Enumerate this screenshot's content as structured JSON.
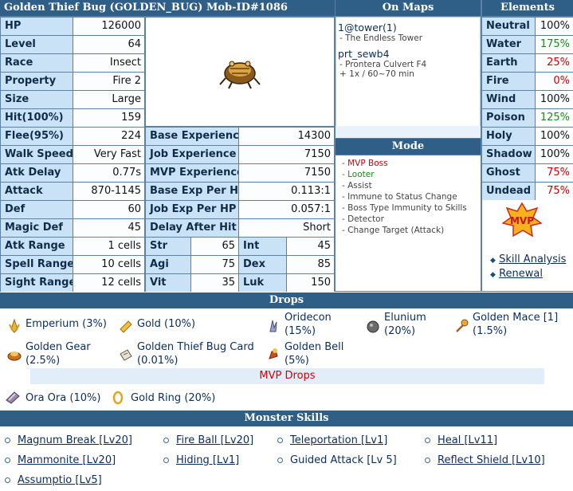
{
  "header": {
    "title": "Golden Thief Bug  (GOLDEN_BUG)  Mob-ID#1086",
    "on_maps": "On Maps",
    "elements": "Elements"
  },
  "stats": {
    "hp": {
      "label": "HP",
      "value": "126000"
    },
    "level": {
      "label": "Level",
      "value": "64"
    },
    "race": {
      "label": "Race",
      "value": "Insect"
    },
    "property": {
      "label": "Property",
      "value": "Fire 2"
    },
    "size": {
      "label": "Size",
      "value": "Large"
    },
    "hit": {
      "label": "Hit(100%)",
      "value": "159"
    },
    "flee": {
      "label": "Flee(95%)",
      "value": "224"
    },
    "walk_speed": {
      "label": "Walk Speed",
      "value": "Very Fast"
    },
    "atk_delay": {
      "label": "Atk Delay",
      "value": "0.77s"
    },
    "attack": {
      "label": "Attack",
      "value": "870-1145"
    },
    "def": {
      "label": "Def",
      "value": "60"
    },
    "magic_def": {
      "label": "Magic Def",
      "value": "45"
    },
    "atk_range": {
      "label": "Atk Range",
      "value": "1 cells"
    },
    "spell_range": {
      "label": "Spell Range",
      "value": "10 cells"
    },
    "sight_range": {
      "label": "Sight Range",
      "value": "12 cells"
    }
  },
  "exp": {
    "base_exp": {
      "label": "Base Experience",
      "value": "14300"
    },
    "job_exp": {
      "label": "Job Experience",
      "value": "7150"
    },
    "mvp_exp": {
      "label": "MVP Experience",
      "value": "7150"
    },
    "base_per_hp": {
      "label": "Base Exp Per HP",
      "value": "0.113:1"
    },
    "job_per_hp": {
      "label": "Job Exp Per HP",
      "value": "0.057:1"
    },
    "delay_after_hit": {
      "label": "Delay After Hit",
      "value": "Short"
    }
  },
  "attrs": {
    "str": {
      "label": "Str",
      "value": "65"
    },
    "int": {
      "label": "Int",
      "value": "45"
    },
    "agi": {
      "label": "Agi",
      "value": "75"
    },
    "dex": {
      "label": "Dex",
      "value": "85"
    },
    "vit": {
      "label": "Vit",
      "value": "35"
    },
    "luk": {
      "label": "Luk",
      "value": "150"
    }
  },
  "maps": [
    {
      "name": "1@tower(1)",
      "sub": "- The Endless Tower"
    },
    {
      "name": "prt_sewb4",
      "sub": "- Prontera Culvert F4",
      "extra": "+ 1x / 60~70 min"
    }
  ],
  "mode": {
    "title": "Mode",
    "items": [
      {
        "text": "- MVP Boss",
        "color": "#d40000"
      },
      {
        "text": "- Looter",
        "color": "#1a8a1a"
      },
      {
        "text": "- Assist",
        "color": "#444444"
      },
      {
        "text": "- Immune to Status Change",
        "color": "#444444"
      },
      {
        "text": "- Boss Type Immunity to Skills",
        "color": "#444444"
      },
      {
        "text": "- Detector",
        "color": "#444444"
      },
      {
        "text": "- Change Target (Attack)",
        "color": "#444444"
      }
    ]
  },
  "elements": [
    {
      "label": "Neutral",
      "value": "100%",
      "color": "#111111"
    },
    {
      "label": "Water",
      "value": "175%",
      "color": "#1a8a1a"
    },
    {
      "label": "Earth",
      "value": "25%",
      "color": "#d40000"
    },
    {
      "label": "Fire",
      "value": "0%",
      "color": "#d40000"
    },
    {
      "label": "Wind",
      "value": "100%",
      "color": "#111111"
    },
    {
      "label": "Poison",
      "value": "125%",
      "color": "#1a8a1a"
    },
    {
      "label": "Holy",
      "value": "100%",
      "color": "#111111"
    },
    {
      "label": "Shadow",
      "value": "100%",
      "color": "#111111"
    },
    {
      "label": "Ghost",
      "value": "75%",
      "color": "#d40000"
    },
    {
      "label": "Undead",
      "value": "75%",
      "color": "#d40000"
    }
  ],
  "mvp_badge": "MVP",
  "links": {
    "skill_analysis": "Skill Analysis",
    "renewal": "Renewal"
  },
  "drops": {
    "title": "Drops",
    "row1": [
      {
        "name": "Emperium",
        "rate": "(3%)",
        "icon": "emperium-icon"
      },
      {
        "name": "Gold",
        "rate": "(10%)",
        "icon": "gold-bar-icon"
      },
      {
        "name": "Oridecon",
        "rate": "(15%)",
        "icon": "oridecon-icon"
      },
      {
        "name": "Elunium",
        "rate": "(20%)",
        "icon": "elunium-icon"
      },
      {
        "name": "Golden Mace [1]",
        "rate": "(1.5%)",
        "icon": "mace-icon"
      }
    ],
    "row2": [
      {
        "name": "Golden Gear",
        "rate": "(2.5%)",
        "icon": "golden-gear-icon"
      },
      {
        "name": "Golden Thief Bug Card",
        "rate": "(0.01%)",
        "icon": "card-icon"
      },
      {
        "name": "Golden Bell",
        "rate": "(5%)",
        "icon": "golden-bell-icon"
      }
    ],
    "mvp_title": "MVP Drops",
    "mvp": [
      {
        "name": "Ora Ora",
        "rate": "(10%)",
        "icon": "ora-ora-icon"
      },
      {
        "name": "Gold Ring",
        "rate": "(20%)",
        "icon": "gold-ring-icon"
      }
    ]
  },
  "skills": {
    "title": "Monster Skills",
    "items": [
      "Magnum Break [Lv20]",
      "Fire Ball [Lv20]",
      "Teleportation [Lv1]",
      "Heal [Lv11]",
      "Mammonite [Lv20]",
      "Hiding [Lv1]",
      "Guided Attack [Lv 5]",
      "Reflect Shield [Lv10]",
      "Assumptio [Lv5]"
    ]
  }
}
